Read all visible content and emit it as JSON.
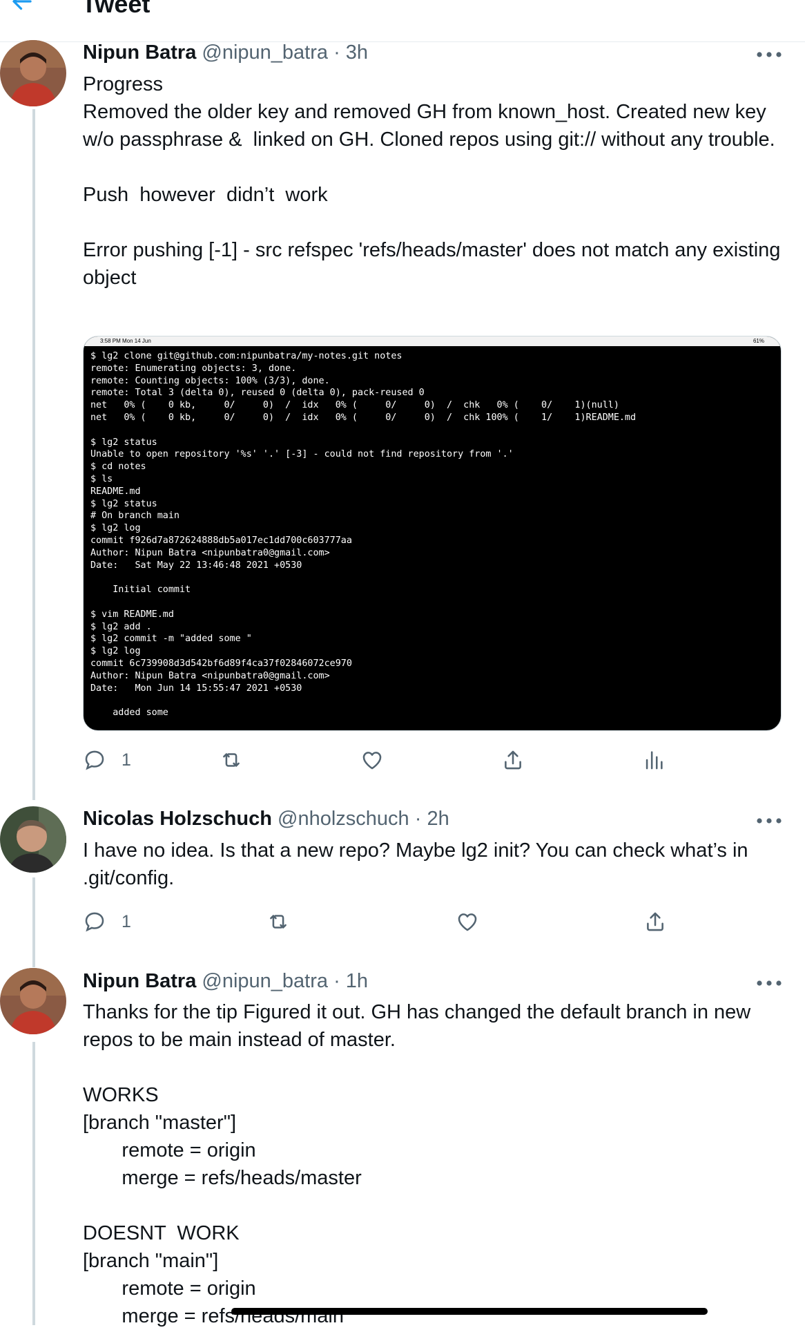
{
  "header": {
    "title": "Tweet"
  },
  "tweets": [
    {
      "name": "Nipun Batra",
      "handle": "@nipun_batra",
      "time": " · 3h",
      "text": "Progress\nRemoved the older key and removed GH from known_host. Created new key w/o passphrase &  linked on GH. Cloned repos using git:// without any trouble.\n\nPush  however  didn’t  work\n\nError pushing [-1] - src refspec 'refs/heads/master' does not match any existing object",
      "reply_count": "1"
    },
    {
      "name": "Nicolas Holzschuch",
      "handle": "@nholzschuch",
      "time": " · 2h",
      "text": "I have no idea. Is that a new repo? Maybe lg2 init? You can check what’s in .git/config.",
      "reply_count": "1"
    },
    {
      "name": "Nipun Batra",
      "handle": "@nipun_batra",
      "time": " · 1h",
      "text": "Thanks for the tip Figured it out. GH has changed the default branch in new repos to be main instead of master.\n\nWORKS\n[branch \"master\"]\n       remote = origin\n       merge = refs/heads/master\n\nDOESNT  WORK\n[branch \"main\"]\n       remote = origin\n       merge = refs/heads/main"
    }
  ],
  "screenshot": {
    "status_time": "3:58 PM  Mon 14 Jun",
    "status_battery": "61%",
    "terminal": "$ lg2 clone git@github.com:nipunbatra/my-notes.git notes\nremote: Enumerating objects: 3, done.\nremote: Counting objects: 100% (3/3), done.\nremote: Total 3 (delta 0), reused 0 (delta 0), pack-reused 0\nnet   0% (    0 kb,     0/     0)  /  idx   0% (     0/     0)  /  chk   0% (    0/    1)(null)\nnet   0% (    0 kb,     0/     0)  /  idx   0% (     0/     0)  /  chk 100% (    1/    1)README.md\n\n$ lg2 status\nUnable to open repository '%s' '.' [-3] - could not find repository from '.'\n$ cd notes\n$ ls\nREADME.md\n$ lg2 status\n# On branch main\n$ lg2 log\ncommit f926d7a872624888db5a017ec1dd700c603777aa\nAuthor: Nipun Batra <nipunbatra0@gmail.com>\nDate:   Sat May 22 13:46:48 2021 +0530\n\n    Initial commit\n\n$ vim README.md\n$ lg2 add .\n$ lg2 commit -m \"added some \"\n$ lg2 log\ncommit 6c739908d3d542bf6d89f4ca37f02846072ce970\nAuthor: Nipun Batra <nipunbatra0@gmail.com>\nDate:   Mon Jun 14 15:55:47 2021 +0530\n\n    added some"
  },
  "icons": {
    "back": "back-arrow-icon",
    "more": "more-horizontal-icon",
    "reply": "reply-bubble-icon",
    "retweet": "retweet-icon",
    "like": "heart-icon",
    "share": "share-icon",
    "analytics": "analytics-bars-icon"
  },
  "colors": {
    "accent": "#1d9bf0",
    "secondary_text": "#536471",
    "thread_line": "#cfd9de"
  }
}
